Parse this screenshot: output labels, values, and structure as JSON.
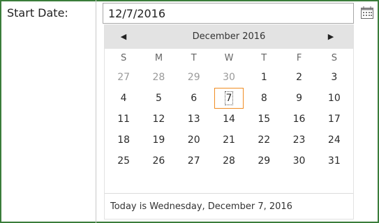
{
  "form": {
    "label": "Start Date:",
    "value": "12/7/2016"
  },
  "calendar": {
    "month_title": "December 2016",
    "prev_glyph": "◀",
    "next_glyph": "▶",
    "weekdays": [
      "S",
      "M",
      "T",
      "W",
      "T",
      "F",
      "S"
    ],
    "weeks": [
      [
        "27",
        "28",
        "29",
        "30",
        "1",
        "2",
        "3"
      ],
      [
        "4",
        "5",
        "6",
        "7",
        "8",
        "9",
        "10"
      ],
      [
        "11",
        "12",
        "13",
        "14",
        "15",
        "16",
        "17"
      ],
      [
        "18",
        "19",
        "20",
        "21",
        "22",
        "23",
        "24"
      ],
      [
        "25",
        "26",
        "27",
        "28",
        "29",
        "30",
        "31"
      ]
    ],
    "other_month_days": [
      [
        0,
        0
      ],
      [
        0,
        1
      ],
      [
        0,
        2
      ],
      [
        0,
        3
      ]
    ],
    "selected": [
      1,
      3
    ],
    "today_text": "Today is Wednesday, December 7, 2016"
  },
  "icons": {
    "calendar": "calendar-icon",
    "prev": "chevron-left-icon",
    "next": "chevron-right-icon"
  },
  "colors": {
    "frame": "#3a7d3a",
    "selected_border": "#f08c22",
    "header_bg": "#e3e3e3"
  }
}
